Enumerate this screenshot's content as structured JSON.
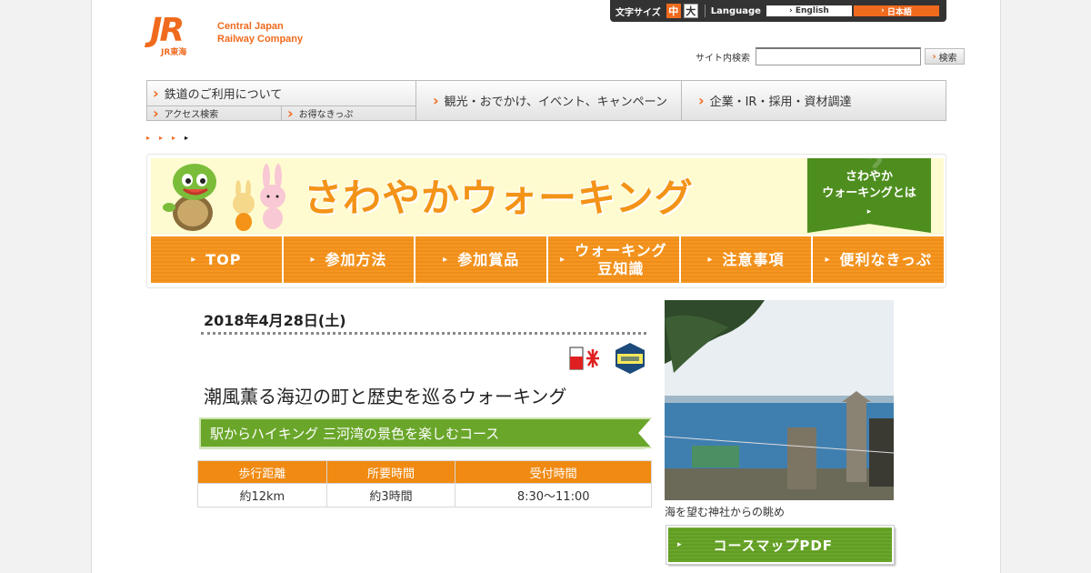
{
  "header": {
    "logo_mark": "JR",
    "logo_sub": "JR東海",
    "company_line1": "Central Japan",
    "company_line2": "Railway Company",
    "font_size_label": "文字サイズ",
    "font_size_mid": "中",
    "font_size_big": "大",
    "language_label": "Language",
    "lang_en": "English",
    "lang_jp": "日本語",
    "search_label": "サイト内検索",
    "search_button": "検索",
    "search_value": ""
  },
  "gnav": {
    "railway": "鉄道のご利用について",
    "access": "アクセス検索",
    "tickets": "お得なきっぷ",
    "tourism": "観光・おでかけ、イベント、キャンペーン",
    "corporate": "企業・IR・採用・資材調達"
  },
  "banner": {
    "title": "さわやかウォーキング",
    "about_line1": "さわやか",
    "about_line2": "ウォーキングとは",
    "tabs": [
      "TOP",
      "参加方法",
      "参加賞品",
      "ウォーキング\n豆知識",
      "注意事項",
      "便利なきっぷ"
    ]
  },
  "event": {
    "date": "2018年4月28日(土)",
    "title": "潮風薫る海辺の町と歴史を巡るウォーキング",
    "station": "駅からハイキング 三河湾の景色を楽しむコース",
    "icons": [
      "kari-icon",
      "ippan-icon"
    ],
    "table": {
      "headers": [
        "歩行距離",
        "所要時間",
        "受付時間"
      ],
      "row": [
        "約12km",
        "約3時間",
        "8:30～11:00"
      ]
    }
  },
  "side": {
    "caption": "海を望む神社からの眺め",
    "pdf_button": "コースマップPDF"
  },
  "colors": {
    "brand_orange": "#f06a1e",
    "tab_orange": "#f49722",
    "green": "#6aa62a"
  }
}
